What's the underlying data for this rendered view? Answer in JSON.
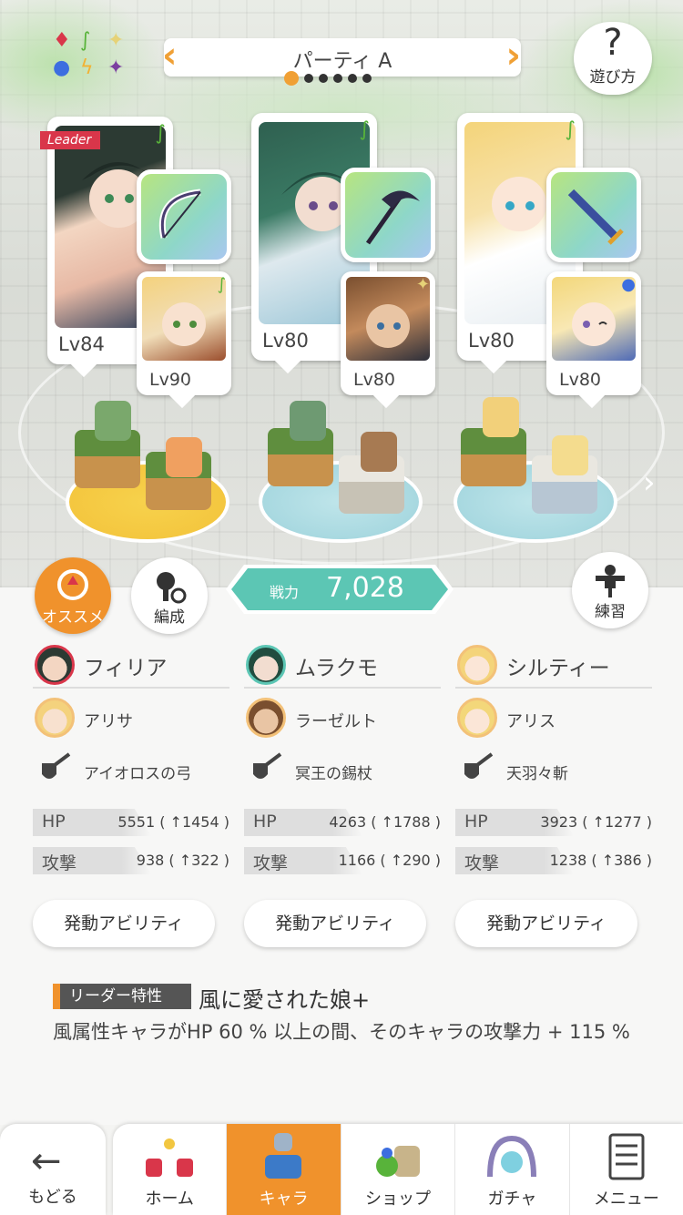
{
  "header": {
    "party_title": "パーティ A",
    "help_label": "遊び方",
    "help_glyph": "?",
    "page_dots": [
      true,
      false,
      false,
      false,
      false,
      false
    ]
  },
  "element_icons": [
    "fire-icon",
    "wind-icon",
    "light-icon",
    "water-icon",
    "thunder-icon",
    "dark-icon"
  ],
  "cards": [
    {
      "leader_label": "Leader",
      "main_lv": "Lv84",
      "sub_lv": "Lv90",
      "main_element": "wind",
      "sub_element": "wind",
      "weapon": "bow"
    },
    {
      "leader_label": "",
      "main_lv": "Lv80",
      "sub_lv": "Lv80",
      "main_element": "wind",
      "sub_element": "light",
      "weapon": "scythe"
    },
    {
      "leader_label": "",
      "main_lv": "Lv80",
      "sub_lv": "Lv80",
      "main_element": "wind",
      "sub_element": "water",
      "weapon": "sword"
    }
  ],
  "actions": {
    "recommend_label": "オススメ",
    "formation_label": "編成",
    "practice_label": "練習"
  },
  "power": {
    "label": "戦力",
    "value": "7,028"
  },
  "columns": [
    {
      "name": "フィリア",
      "sub_name": "アリサ",
      "weapon": "アイオロスの弓",
      "hp_label": "HP",
      "hp": "5551 ( ↑1454 )",
      "atk_label": "攻撃",
      "atk": "938 ( ↑322 )",
      "ability": "発動アビリティ"
    },
    {
      "name": "ムラクモ",
      "sub_name": "ラーゼルト",
      "weapon": "冥王の錫杖",
      "hp_label": "HP",
      "hp": "4263 ( ↑1788 )",
      "atk_label": "攻撃",
      "atk": "1166 ( ↑290 )",
      "ability": "発動アビリティ"
    },
    {
      "name": "シルティー",
      "sub_name": "アリス",
      "weapon": "天羽々斬",
      "hp_label": "HP",
      "hp": "3923 ( ↑1277 )",
      "atk_label": "攻撃",
      "atk": "1238 ( ↑386 )",
      "ability": "発動アビリティ"
    }
  ],
  "leader_skill": {
    "tag": "リーダー特性",
    "name": "風に愛された娘+",
    "desc": "風属性キャラがHP 60 % 以上の間、そのキャラの攻撃力 + 115 %"
  },
  "nav": {
    "back_label": "もどる",
    "tabs": [
      {
        "label": "ホーム",
        "active": false
      },
      {
        "label": "キャラ",
        "active": true
      },
      {
        "label": "ショップ",
        "active": false
      },
      {
        "label": "ガチャ",
        "active": false
      },
      {
        "label": "メニュー",
        "active": false
      }
    ]
  },
  "colors": {
    "accent": "#f0922c",
    "leader_red": "#d9364a",
    "power_teal": "#5cc6b4",
    "wind_green": "#58b33a"
  }
}
